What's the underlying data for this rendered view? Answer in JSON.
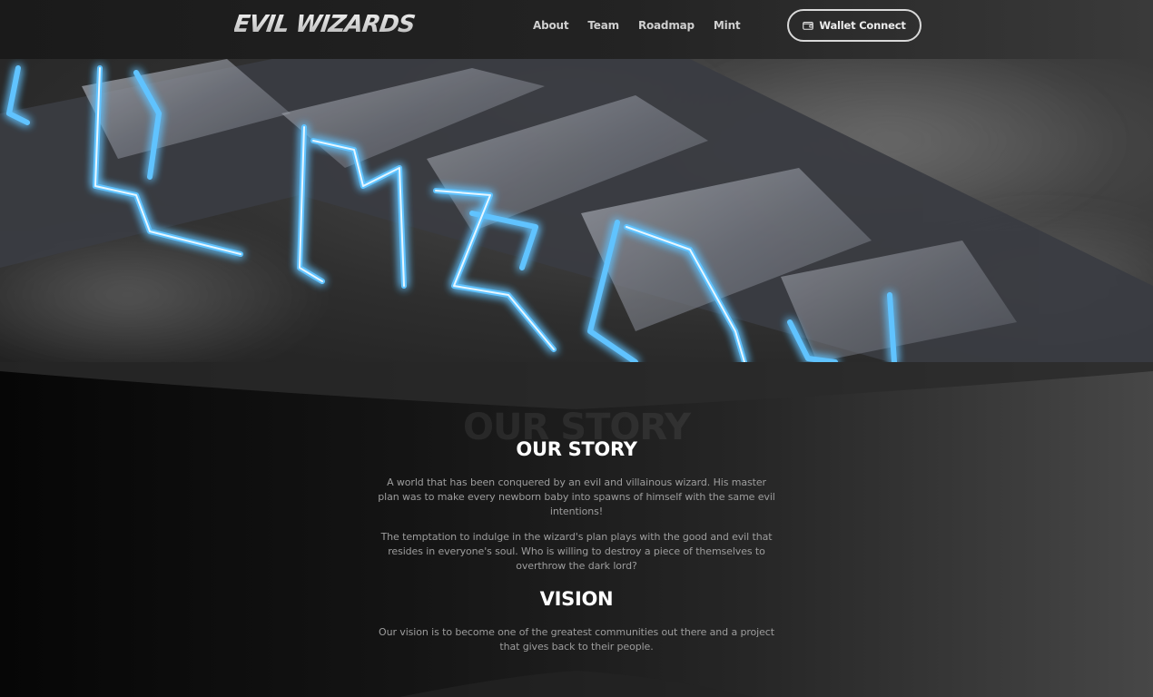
{
  "brand": {
    "logo_text": "EVIL WIZARDS"
  },
  "nav": {
    "items": [
      "About",
      "Team",
      "Roadmap",
      "Mint"
    ],
    "wallet_button": "Wallet Connect",
    "wallet_icon": "wallet-icon"
  },
  "hero": {
    "sign_text": "EVIL WIZARDS",
    "glow_color": "#4db8ff"
  },
  "story": {
    "ghost_title": "OUR STORY",
    "title": "OUR STORY",
    "paragraph_1": "A world that has been conquered by an evil and villainous wizard. His master plan was to make every newborn baby into spawns of himself with the same evil intentions!",
    "paragraph_2": "The temptation to indulge in the wizard's plan plays with the good and evil that resides in everyone's soul. Who is willing to destroy a piece of themselves to overthrow the dark lord?"
  },
  "vision": {
    "title": "VISION",
    "paragraph": "Our vision is to become one of the greatest communities out there and a project that gives back to their people."
  }
}
